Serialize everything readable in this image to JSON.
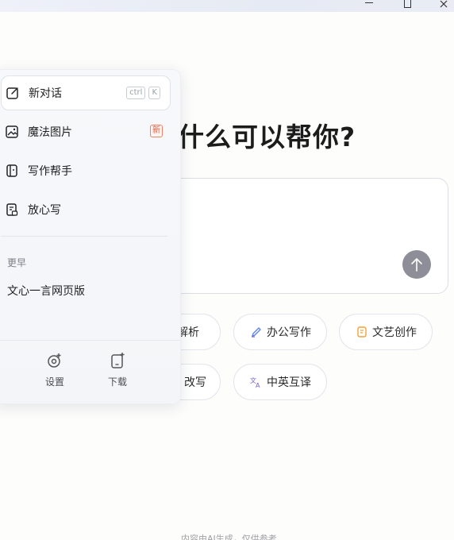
{
  "window": {
    "controls": [
      "minimize-icon",
      "maximize-icon",
      "close-icon"
    ]
  },
  "main": {
    "headline": "什么可以帮你?",
    "send_icon": "arrow-up-icon",
    "chips": [
      {
        "label": "解析",
        "icon": "analysis-icon"
      },
      {
        "label": "办公写作",
        "icon": "pen-icon"
      },
      {
        "label": "文艺创作",
        "icon": "document-icon"
      },
      {
        "label": "改写",
        "icon": "rewrite-icon"
      },
      {
        "label": "中英互译",
        "icon": "translate-icon"
      }
    ],
    "footer_note": "内容由AI生成，仅供参考"
  },
  "panel": {
    "nav": [
      {
        "label": "新对话",
        "icon": "edit-icon",
        "shortcut": [
          "ctrl",
          "K"
        ]
      },
      {
        "label": "魔法图片",
        "icon": "image-icon",
        "badge": "新"
      },
      {
        "label": "写作帮手",
        "icon": "notebook-icon"
      },
      {
        "label": "放心写",
        "icon": "secure-doc-icon"
      }
    ],
    "section_label": "更早",
    "history": [
      {
        "label": "文心一言网页版"
      }
    ],
    "tools": [
      {
        "label": "设置",
        "icon": "settings-icon"
      },
      {
        "label": "下载",
        "icon": "download-device-icon"
      }
    ]
  },
  "colors": {
    "accent_purple": "#7b5fd0",
    "accent_orange": "#f0a23a",
    "accent_blue": "#5b7fe6",
    "badge_red": "#e05a3a",
    "send_button": "#8e8e98"
  }
}
